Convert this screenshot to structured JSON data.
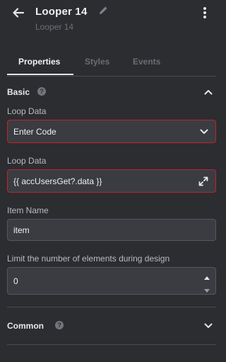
{
  "header": {
    "title": "Looper 14",
    "subtitle": "Looper 14",
    "icons": [
      "arrow-left-icon",
      "pencil-icon",
      "more-vertical-icon"
    ]
  },
  "tabs": [
    {
      "label": "Properties",
      "active": true
    },
    {
      "label": "Styles",
      "active": false
    },
    {
      "label": "Events",
      "active": false
    }
  ],
  "basic": {
    "title": "Basic",
    "help_glyph": "?",
    "expanded": true,
    "loop_data_mode": {
      "label": "Loop Data",
      "value": "Enter Code",
      "error": true
    },
    "loop_data_code": {
      "label": "Loop Data",
      "value": "{{ accUsersGet?.data }}",
      "error": true
    },
    "item_name": {
      "label": "Item Name",
      "value": "item"
    },
    "limit": {
      "label": "Limit the number of elements during design",
      "value": "0"
    }
  },
  "common": {
    "title": "Common",
    "help_glyph": "?",
    "expanded": false
  },
  "colors": {
    "background": "#2b2d31",
    "error_border": "#c0242c",
    "field_bg": "#3a3c41"
  }
}
